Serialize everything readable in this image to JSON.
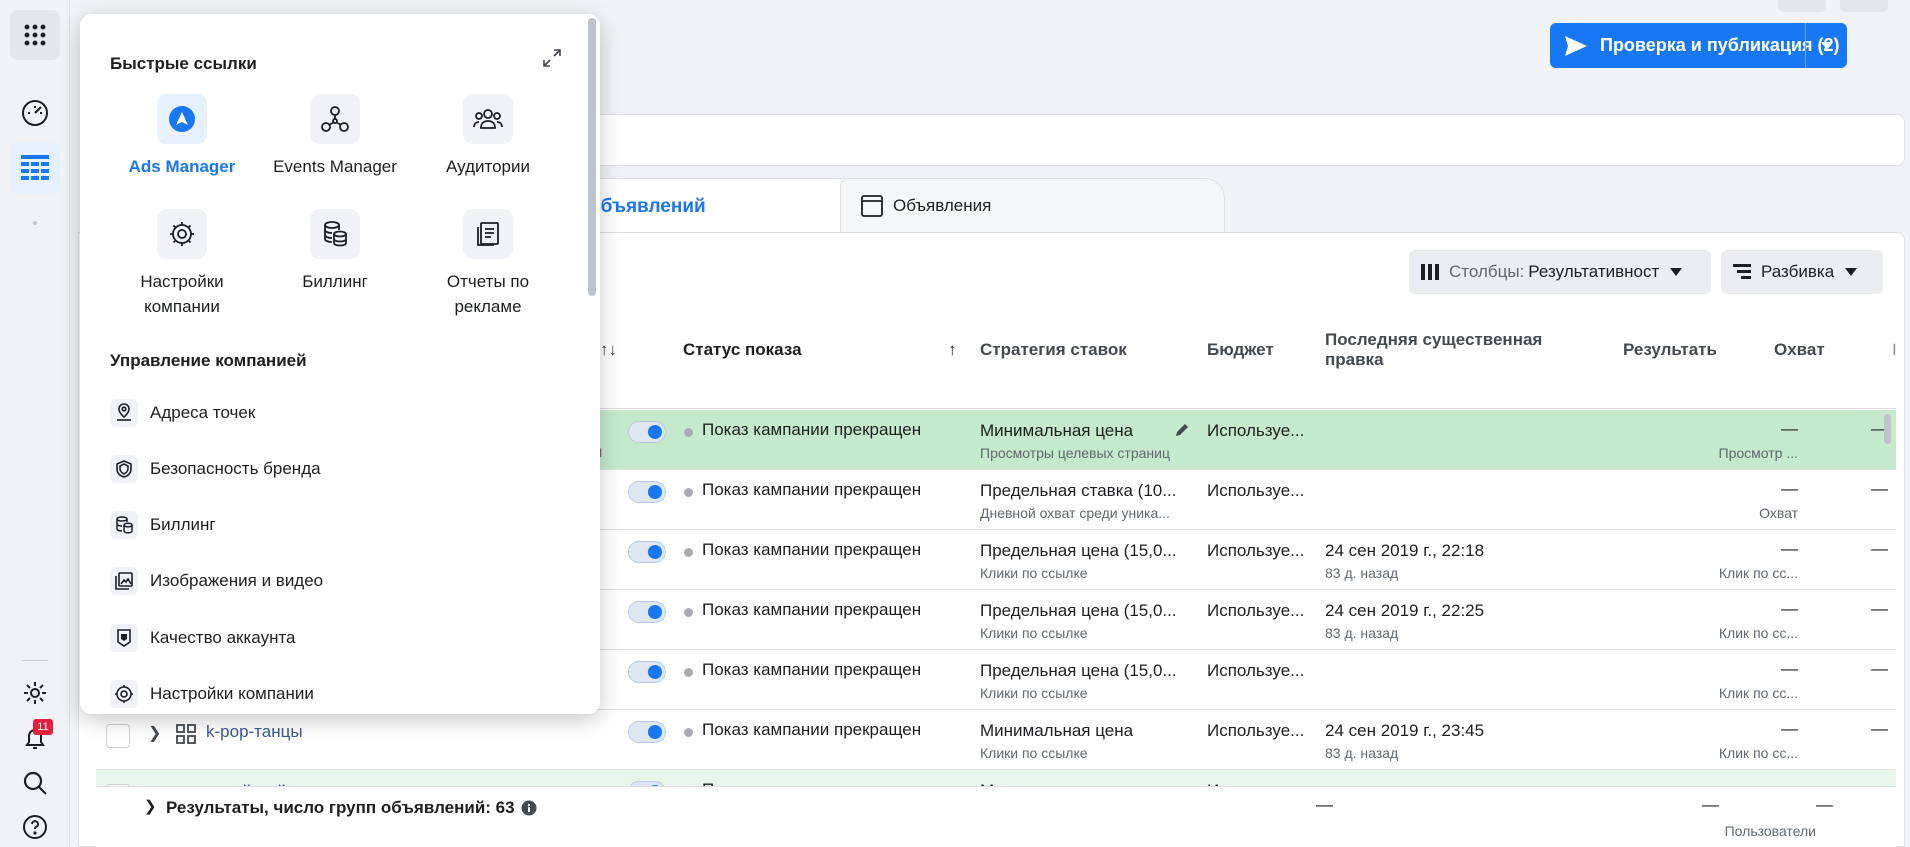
{
  "colors": {
    "accent": "#1877f2",
    "highlight_row": "#c5e9cd",
    "badge": "#e41e3f"
  },
  "rail": {
    "notifications_count": "11"
  },
  "header": {
    "publish_label": "Проверка и публикация (2)"
  },
  "tabs": {
    "ad_sets": "объявлений",
    "ads": "Объявления"
  },
  "toolbar": {
    "columns_prefix": "Столбцы:",
    "columns_value": "Результативност",
    "breakdown": "Разбивка"
  },
  "table": {
    "headers": {
      "status": "Статус показа",
      "strategy": "Стратегия ставок",
      "budget": "Бюджет",
      "last_edit": "Последняя существенная правка",
      "results": "Результать",
      "reach": "Охват",
      "more": "I"
    },
    "rows": [
      {
        "status": "Показ кампании прекращен",
        "strategy": "Минимальная цена",
        "strategy_sub": "Просмотры целевых страниц",
        "budget": "Используе...",
        "edit": "",
        "edit_sub": "",
        "result": "—",
        "result_sub": "Просмотр ...",
        "reach": "—",
        "partial": "ти",
        "name": ""
      },
      {
        "status": "Показ кампании прекращен",
        "strategy": "Предельная ставка (10...",
        "strategy_sub": "Дневной охват среди уника...",
        "budget": "Используе...",
        "edit": "",
        "edit_sub": "",
        "result": "—",
        "result_sub": "Охват",
        "reach": "—",
        "partial": "",
        "name": ""
      },
      {
        "status": "Показ кампании прекращен",
        "strategy": "Предельная цена (15,0...",
        "strategy_sub": "Клики по ссылке",
        "budget": "Используе...",
        "edit": "24 сен 2019 г., 22:18",
        "edit_sub": "83 д. назад",
        "result": "—",
        "result_sub": "Клик по сс...",
        "reach": "—",
        "partial": "",
        "name": ""
      },
      {
        "status": "Показ кампании прекращен",
        "strategy": "Предельная цена (15,0...",
        "strategy_sub": "Клики по ссылке",
        "budget": "Используе...",
        "edit": "24 сен 2019 г., 22:25",
        "edit_sub": "83 д. назад",
        "result": "—",
        "result_sub": "Клик по сс...",
        "reach": "—",
        "partial": "",
        "name": ""
      },
      {
        "status": "Показ кампании прекращен",
        "strategy": "Предельная цена (15,0...",
        "strategy_sub": "Клики по ссылке",
        "budget": "Используе...",
        "edit": "",
        "edit_sub": "",
        "result": "—",
        "result_sub": "Клик по сс...",
        "reach": "—",
        "partial": "",
        "name": ""
      },
      {
        "status": "Показ кампании прекращен",
        "strategy": "Минимальная цена",
        "strategy_sub": "Клики по ссылке",
        "budget": "Используе...",
        "edit": "24 сен 2019 г., 23:45",
        "edit_sub": "83 д. назад",
        "result": "—",
        "result_sub": "Клик по сс...",
        "reach": "—",
        "partial": "",
        "name": "k-pop-танцы"
      },
      {
        "status": "Показ кампании прекращен",
        "strategy": "М",
        "strategy_sub": "",
        "budget": "И",
        "edit": "",
        "edit_sub": "",
        "result": "",
        "result_sub": "",
        "reach": "",
        "partial": "",
        "name": "корейский"
      }
    ]
  },
  "footer": {
    "label": "Результаты, число групп объявлений: 63",
    "dash1": "—",
    "dash2": "—",
    "dash3": "—",
    "sub": "Пользователи"
  },
  "popover": {
    "quick_links_title": "Быстрые ссылки",
    "quick_links": [
      {
        "label": "Ads Manager",
        "icon": "ads-manager-icon"
      },
      {
        "label": "Events Manager",
        "icon": "events-manager-icon"
      },
      {
        "label": "Аудитории",
        "icon": "audiences-icon"
      },
      {
        "label": "Настройки компании",
        "icon": "gear-icon"
      },
      {
        "label": "Биллинг",
        "icon": "coins-icon"
      },
      {
        "label": "Отчеты по рекламе",
        "icon": "reports-icon"
      }
    ],
    "management_title": "Управление компанией",
    "management": [
      {
        "label": "Адреса точек",
        "icon": "location-icon"
      },
      {
        "label": "Безопасность бренда",
        "icon": "shield-icon"
      },
      {
        "label": "Биллинг",
        "icon": "coins-icon"
      },
      {
        "label": "Изображения и видео",
        "icon": "media-icon"
      },
      {
        "label": "Качество аккаунта",
        "icon": "account-quality-icon"
      },
      {
        "label": "Настройки компании",
        "icon": "gear-icon"
      }
    ]
  }
}
